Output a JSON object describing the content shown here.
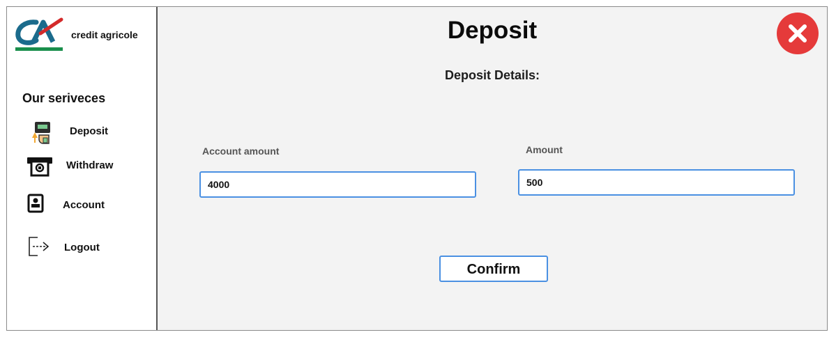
{
  "brand": {
    "name": "credit agricole"
  },
  "sidebar": {
    "services_title": "Our seriveces",
    "items": [
      {
        "label": "Deposit",
        "icon": "atm-deposit-icon"
      },
      {
        "label": "Withdraw",
        "icon": "atm-withdraw-icon"
      },
      {
        "label": "Account",
        "icon": "account-icon"
      },
      {
        "label": "Logout",
        "icon": "logout-icon"
      }
    ]
  },
  "main": {
    "title": "Deposit",
    "section_title": "Deposit Details:",
    "account_amount": {
      "label": "Account amount",
      "value": "4000"
    },
    "amount": {
      "label": "Amount",
      "value": "500"
    },
    "confirm_label": "Confirm",
    "close_icon": "close-icon"
  },
  "colors": {
    "accent": "#4a90e2",
    "close": "#e53a3a",
    "brand_green": "#1a8f4c",
    "brand_red": "#d42a2a",
    "brand_blue": "#1b6b8c",
    "panel": "#f3f3f3"
  }
}
